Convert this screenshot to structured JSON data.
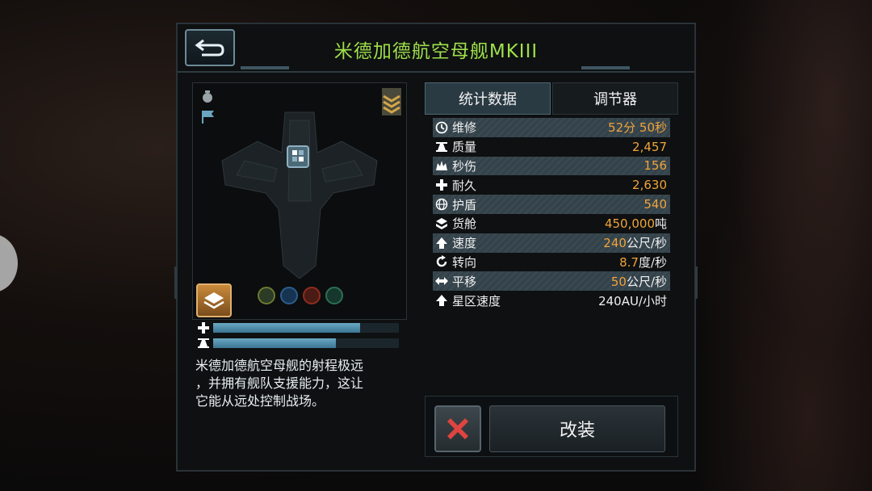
{
  "header": {
    "title": "米德加德航空母舰MKIII"
  },
  "tabs": [
    {
      "label": "统计数据",
      "active": true
    },
    {
      "label": "调节器",
      "active": false
    }
  ],
  "stats": [
    {
      "label": "维修",
      "value": "52分 50秒",
      "icon": "clock-icon",
      "striped": true
    },
    {
      "label": "质量",
      "value": "2,457",
      "icon": "mass-icon",
      "striped": false
    },
    {
      "label": "秒伤",
      "value": "156",
      "icon": "damage-icon",
      "striped": true
    },
    {
      "label": "耐久",
      "value": "2,630",
      "icon": "durability-icon",
      "striped": false
    },
    {
      "label": "护盾",
      "value": "540",
      "icon": "shield-icon",
      "striped": true
    },
    {
      "label": "货舱",
      "value": "450,000",
      "unit": "吨",
      "icon": "cargo-icon",
      "striped": false
    },
    {
      "label": "速度",
      "value": "240",
      "unit": "公尺/秒",
      "icon": "speed-icon",
      "striped": true
    },
    {
      "label": "转向",
      "value": "8.7",
      "unit": "度/秒",
      "icon": "turn-icon",
      "striped": false
    },
    {
      "label": "平移",
      "value": "50",
      "unit": "公尺/秒",
      "icon": "strafe-icon",
      "striped": true
    },
    {
      "label": "星区速度",
      "value": "240AU/小时",
      "icon": "warp-icon",
      "striped": false,
      "white": true
    }
  ],
  "bars": {
    "durability_fraction": 0.79,
    "mass_fraction": 0.66
  },
  "description": {
    "lines": [
      "米德加德航空母舰的射程极远",
      "，并拥有舰队支援能力，这让",
      "它能从远处控制战场。"
    ]
  },
  "buttons": {
    "modify_label": "改装"
  },
  "colors": {
    "title": "#9fe04a",
    "value": "#f0a43a",
    "bar": "#4e8cab",
    "cancel_x": "#e0443f"
  }
}
